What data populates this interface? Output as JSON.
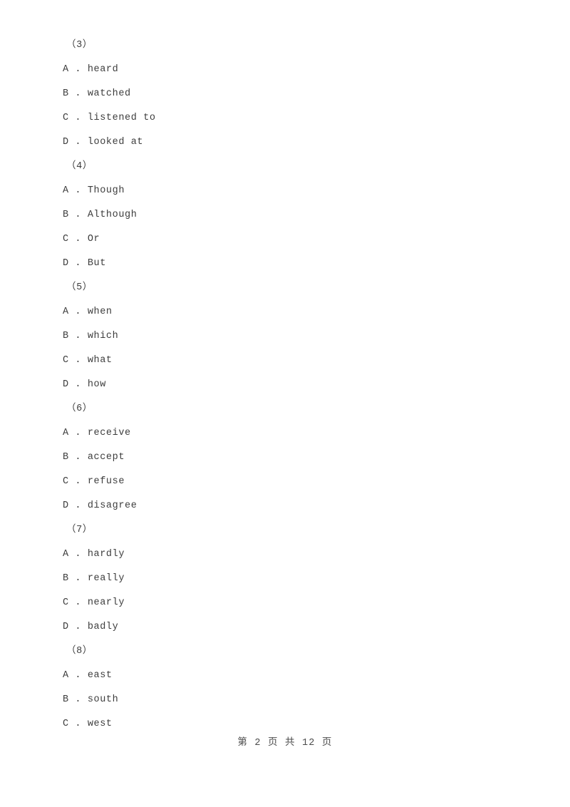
{
  "document": {
    "page_label": "第 2 页 共 12 页",
    "background_color": "#ffffff",
    "text_color": "#3d3d3d"
  },
  "questions": [
    {
      "number": "（3）",
      "options": [
        {
          "letter": "A",
          "separator": " . ",
          "text": "heard"
        },
        {
          "letter": "B",
          "separator": " . ",
          "text": "watched"
        },
        {
          "letter": "C",
          "separator": " . ",
          "text": "listened to"
        },
        {
          "letter": "D",
          "separator": " . ",
          "text": "looked at"
        }
      ]
    },
    {
      "number": "（4）",
      "options": [
        {
          "letter": "A",
          "separator": " . ",
          "text": "Though"
        },
        {
          "letter": "B",
          "separator": " . ",
          "text": "Although"
        },
        {
          "letter": "C",
          "separator": " . ",
          "text": "Or"
        },
        {
          "letter": "D",
          "separator": " . ",
          "text": "But"
        }
      ]
    },
    {
      "number": "（5）",
      "options": [
        {
          "letter": "A",
          "separator": " . ",
          "text": "when"
        },
        {
          "letter": "B",
          "separator": " . ",
          "text": "which"
        },
        {
          "letter": "C",
          "separator": " . ",
          "text": "what"
        },
        {
          "letter": "D",
          "separator": " . ",
          "text": "how"
        }
      ]
    },
    {
      "number": "（6）",
      "options": [
        {
          "letter": "A",
          "separator": " . ",
          "text": "receive"
        },
        {
          "letter": "B",
          "separator": " . ",
          "text": "accept"
        },
        {
          "letter": "C",
          "separator": " . ",
          "text": "refuse"
        },
        {
          "letter": "D",
          "separator": " . ",
          "text": "disagree"
        }
      ]
    },
    {
      "number": "（7）",
      "options": [
        {
          "letter": "A",
          "separator": " . ",
          "text": "hardly"
        },
        {
          "letter": "B",
          "separator": " . ",
          "text": "really"
        },
        {
          "letter": "C",
          "separator": " . ",
          "text": "nearly"
        },
        {
          "letter": "D",
          "separator": " . ",
          "text": "badly"
        }
      ]
    },
    {
      "number": "（8）",
      "options": [
        {
          "letter": "A",
          "separator": " . ",
          "text": "east"
        },
        {
          "letter": "B",
          "separator": " . ",
          "text": "south"
        },
        {
          "letter": "C",
          "separator": " . ",
          "text": "west"
        }
      ]
    }
  ]
}
